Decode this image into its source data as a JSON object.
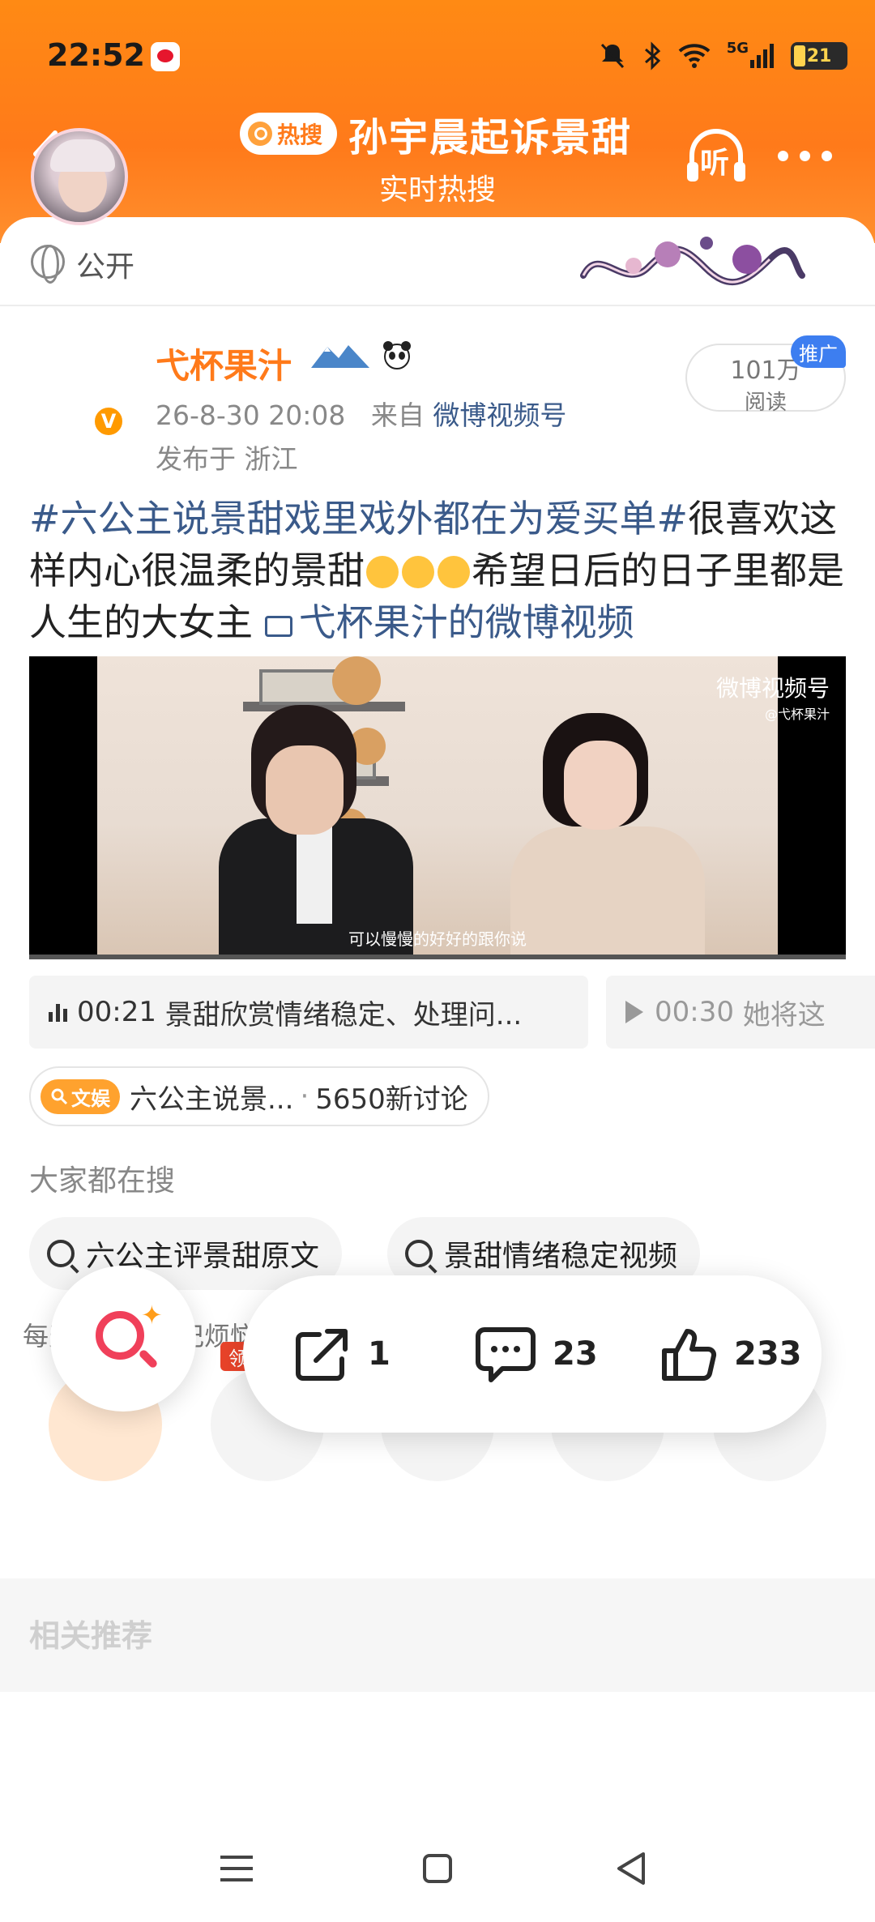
{
  "status_bar": {
    "time": "22:52",
    "network": "5G",
    "battery": "21",
    "icons": [
      "weibo-app-icon",
      "mute-icon",
      "bluetooth-icon",
      "wifi-icon",
      "signal-icon",
      "battery-icon"
    ]
  },
  "header": {
    "hot_badge": "热搜",
    "title": "孙宇晨起诉景甜",
    "subtitle": "实时热搜",
    "listen_label": "听",
    "accent_color": "#ff7a1a"
  },
  "visibility": {
    "label": "公开"
  },
  "post": {
    "author": "弋杯果汁",
    "timestamp": "26-8-30 20:08",
    "source_prefix": "来自",
    "source": "微博视频号",
    "location": "发布于 浙江",
    "read_count": "101万",
    "read_label": "阅读",
    "promo_tag": "推广",
    "verified_mark": "V",
    "body": {
      "hashtag": "#六公主说景甜戏里戏外都在为爱买单#",
      "text_1": "很喜欢这样内心很温柔的景甜",
      "text_2": "希望日后的日子里都是人生的大女主 ",
      "video_link": "弋杯果汁的微博视频"
    },
    "video": {
      "watermark": "微博视频号",
      "watermark_handle": "@弋杯果汁",
      "subtitle": "可以慢慢的好好的跟你说"
    },
    "chapters": [
      {
        "time": "00:21",
        "title": "景甜欣赏情绪稳定、处理问..."
      },
      {
        "time": "00:30",
        "title": "她将这"
      }
    ],
    "topic": {
      "badge": "文娱",
      "name": "六公主说景...",
      "separator": "·",
      "discussions": "5650新讨论"
    }
  },
  "search_suggest": {
    "heading": "大家都在搜",
    "chips": [
      "六公主评景甜原文",
      "景甜情绪稳定视频"
    ]
  },
  "share": {
    "caption": "每天开心，忘记烦恼",
    "redpacket_label": "领红包",
    "items": [
      "weibo-share-icon",
      "wechat-share-icon",
      "moments-share-icon",
      "qq-share-icon",
      "save-image-icon"
    ]
  },
  "related": {
    "label": "相关推荐"
  },
  "actions": {
    "repost_count": "1",
    "comment_count": "23",
    "like_count": "233"
  }
}
